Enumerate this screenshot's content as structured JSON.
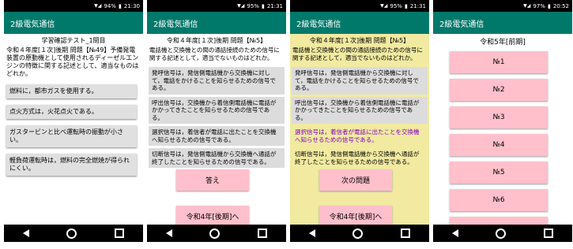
{
  "status": {
    "battery": "94%",
    "time": "21:30"
  },
  "status2": {
    "battery": "95%",
    "time": "21:31"
  },
  "status3": {
    "battery": "95%",
    "time": "21:31"
  },
  "status4": {
    "battery": "97%",
    "time": "20:52"
  },
  "app_title": "2級電気通信",
  "screen1": {
    "title": "学習確認テスト_1問目",
    "question": "令和４年度[１次]後期 問題【№49】予備発電装置の原動機として使用されるディーゼルエンジンの特徴に関する記述として、適当なものはどれか。",
    "options": [
      "燃料に，都市ガスを使用する。",
      "点火方式は，火花点火である。",
      "ガスタービンと比べ運転時の振動が小さい。",
      "軽負荷運転時は，燃料の完全燃焼が得られにくい。"
    ]
  },
  "screen2": {
    "title": "令和４年度[１次]後期 問題【№5】",
    "question": "電話機と交換機との間の通話接続のための信号に関する記述として，適当でないものはどれか。",
    "options": [
      "発呼信号は，発信側電話機から交換機に対して，電話をかけることを知らせるための信号である。",
      "呼出信号は，交換機から着信側電話機に電話がかかってきたことを知らせるための信号である。",
      "選択信号は，着信者が電話に出たことを交換機へ知らせるための信号である。",
      "切断信号は，発信側電話機から交換機へ通話が終了したことを知らせるための信号である。"
    ],
    "answer_button": "答え",
    "next_button": "令和4年[後期]へ"
  },
  "screen3": {
    "title": "令和４年度[１次]後期 問題【№5】",
    "next_question_button": "次の問題",
    "back_button": "令和4年[後期]へ"
  },
  "screen4": {
    "title": "令和5年[前期]",
    "items": [
      "№1",
      "№2",
      "№3",
      "№4",
      "№5",
      "№6"
    ]
  }
}
